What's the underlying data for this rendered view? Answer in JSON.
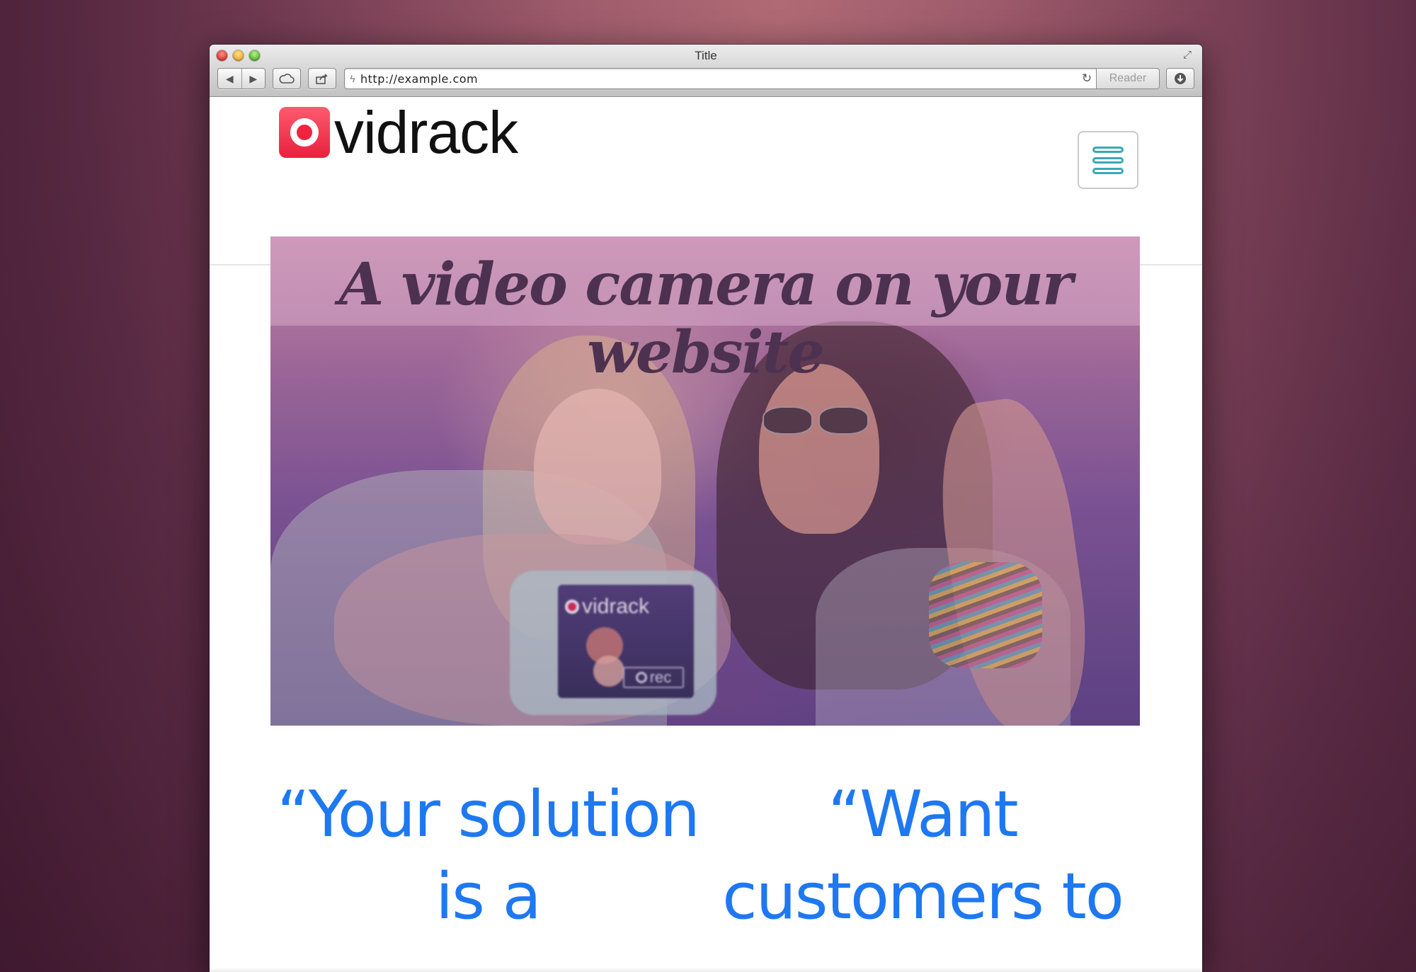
{
  "window": {
    "title": "Title"
  },
  "toolbar": {
    "back_glyph": "◀",
    "forward_glyph": "▶",
    "icloud_icon": "cloud-icon",
    "share_icon": "share-icon",
    "url": "http://example.com",
    "reader_label": "Reader",
    "download_icon": "download-icon"
  },
  "site": {
    "logo_text": "vidrack",
    "hero_title": "A video camera on your website",
    "phone_logo_text": "vidrack",
    "rec_label": "rec",
    "quotes": [
      "“Your solution is a",
      "“Want customers to"
    ],
    "colors": {
      "accent_red": "#e8213d",
      "menu_teal": "#3aa7b4",
      "quote_blue": "#1e78f0"
    }
  }
}
